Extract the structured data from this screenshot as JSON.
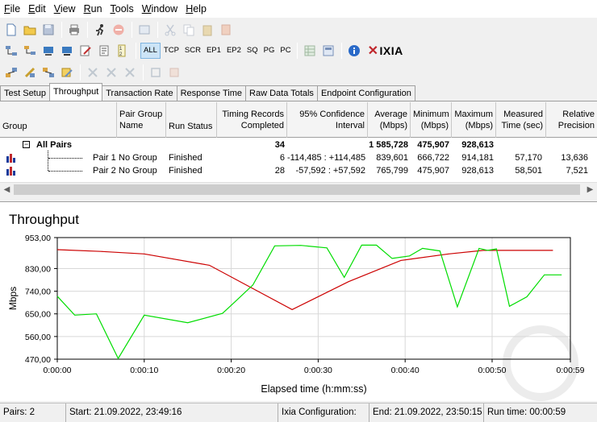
{
  "menu": [
    {
      "label": "File",
      "key": "F",
      "rest": "ile"
    },
    {
      "label": "Edit",
      "key": "E",
      "rest": "dit"
    },
    {
      "label": "View",
      "key": "V",
      "rest": "iew"
    },
    {
      "label": "Run",
      "key": "R",
      "rest": "un"
    },
    {
      "label": "Tools",
      "key": "T",
      "rest": "ools"
    },
    {
      "label": "Window",
      "key": "W",
      "rest": "indow"
    },
    {
      "label": "Help",
      "key": "H",
      "rest": "elp"
    }
  ],
  "toolbar2": {
    "filters": [
      "ALL",
      "TCP",
      "SCR",
      "EP1",
      "EP2",
      "SQ",
      "PG",
      "PC"
    ],
    "brand": "IXIA"
  },
  "tabs": [
    "Test Setup",
    "Throughput",
    "Transaction Rate",
    "Response Time",
    "Raw Data Totals",
    "Endpoint Configuration"
  ],
  "active_tab": "Throughput",
  "grid": {
    "headers": {
      "group": "Group",
      "pair_group_name": [
        "Pair Group",
        "Name"
      ],
      "run_status": "Run Status",
      "timing_records": [
        "Timing Records",
        "Completed"
      ],
      "confidence": [
        "95% Confidence",
        "Interval"
      ],
      "average": [
        "Average",
        "(Mbps)"
      ],
      "minimum": [
        "Minimum",
        "(Mbps)"
      ],
      "maximum": [
        "Maximum",
        "(Mbps)"
      ],
      "measured": [
        "Measured",
        "Time (sec)"
      ],
      "relative": [
        "Relative",
        "Precision"
      ]
    },
    "summary": {
      "expander": "−",
      "label": "All Pairs",
      "timing_records": "34",
      "average": "1 585,728",
      "minimum": "475,907",
      "maximum": "928,613"
    },
    "rows": [
      {
        "pair": "Pair 1",
        "group": "No Group",
        "status": "Finished",
        "records": "6",
        "confidence": "-114,485 : +114,485",
        "average": "839,601",
        "minimum": "666,722",
        "maximum": "914,181",
        "measured": "57,170",
        "relative": "13,636"
      },
      {
        "pair": "Pair 2",
        "group": "No Group",
        "status": "Finished",
        "records": "28",
        "confidence": "-57,592 : +57,592",
        "average": "765,799",
        "minimum": "475,907",
        "maximum": "928,613",
        "measured": "58,501",
        "relative": "7,521"
      }
    ]
  },
  "chart_data": {
    "type": "line",
    "title": "Throughput",
    "xlabel": "Elapsed time (h:mm:ss)",
    "ylabel": "Mbps",
    "xlim": [
      0,
      59
    ],
    "ylim": [
      470,
      953
    ],
    "yticks": [
      "953,00",
      "830,00",
      "740,00",
      "650,00",
      "560,00",
      "470,00"
    ],
    "ytick_values": [
      953,
      830,
      740,
      650,
      560,
      470
    ],
    "xticks": [
      "0:00:00",
      "0:00:10",
      "0:00:20",
      "0:00:30",
      "0:00:40",
      "0:00:50",
      "0:00:59"
    ],
    "xtick_values": [
      0,
      10,
      20,
      30,
      40,
      50,
      59
    ],
    "grid": true,
    "series": [
      {
        "color": "#cc0000",
        "x": [
          0,
          5,
          10,
          17.5,
          27,
          33.5,
          39.5,
          45,
          49,
          57
        ],
        "y": [
          905,
          898,
          888,
          843,
          667,
          778,
          862,
          888,
          902,
          902
        ]
      },
      {
        "color": "#00dd00",
        "x": [
          0,
          2,
          4.5,
          7,
          10,
          15,
          19,
          20.5,
          22.5,
          25,
          28,
          31,
          33,
          35,
          36.7,
          38.5,
          40.5,
          42,
          44,
          46,
          48.5,
          49.5,
          50.5,
          52,
          54,
          56,
          58
        ],
        "y": [
          720,
          645,
          650,
          473,
          645,
          615,
          652,
          700,
          765,
          920,
          922,
          912,
          795,
          923,
          923,
          870,
          880,
          910,
          900,
          678,
          910,
          902,
          908,
          680,
          718,
          805,
          805
        ]
      }
    ]
  },
  "status": {
    "pairs": "Pairs: 2",
    "start": "Start: 21.09.2022, 23:49:16",
    "ixia_config": "Ixia Configuration:",
    "end": "End: 21.09.2022, 23:50:15",
    "run_time": "Run time: 00:00:59"
  }
}
